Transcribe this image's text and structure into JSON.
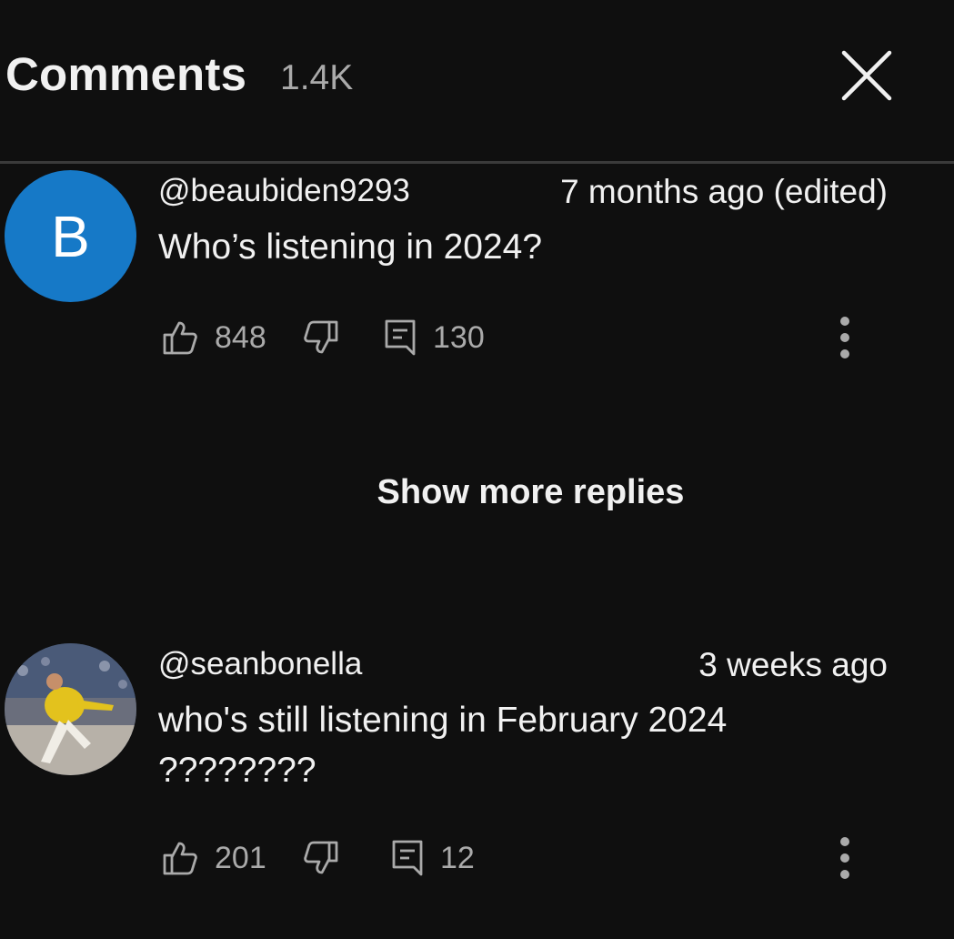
{
  "header": {
    "title": "Comments",
    "count": "1.4K"
  },
  "comments": [
    {
      "avatar_letter": "B",
      "avatar_color": "#1679c7",
      "author": "@beaubiden9293",
      "time": "7 months ago (edited)",
      "text": "Who’s listening in 2024?",
      "likes": "848",
      "replies": "130"
    },
    {
      "avatar_image": "person-in-yellow-jacket-on-stage",
      "author": "@seanbonella",
      "time": "3 weeks ago",
      "text": "who's still listening in February 2024 ????????",
      "likes": "201",
      "replies": "12"
    }
  ],
  "show_more_replies_label": "Show more replies",
  "colors": {
    "background": "#0f0f0f",
    "text": "#f1f1f1",
    "muted": "#aaaaaa",
    "divider": "#3a3a3a"
  }
}
